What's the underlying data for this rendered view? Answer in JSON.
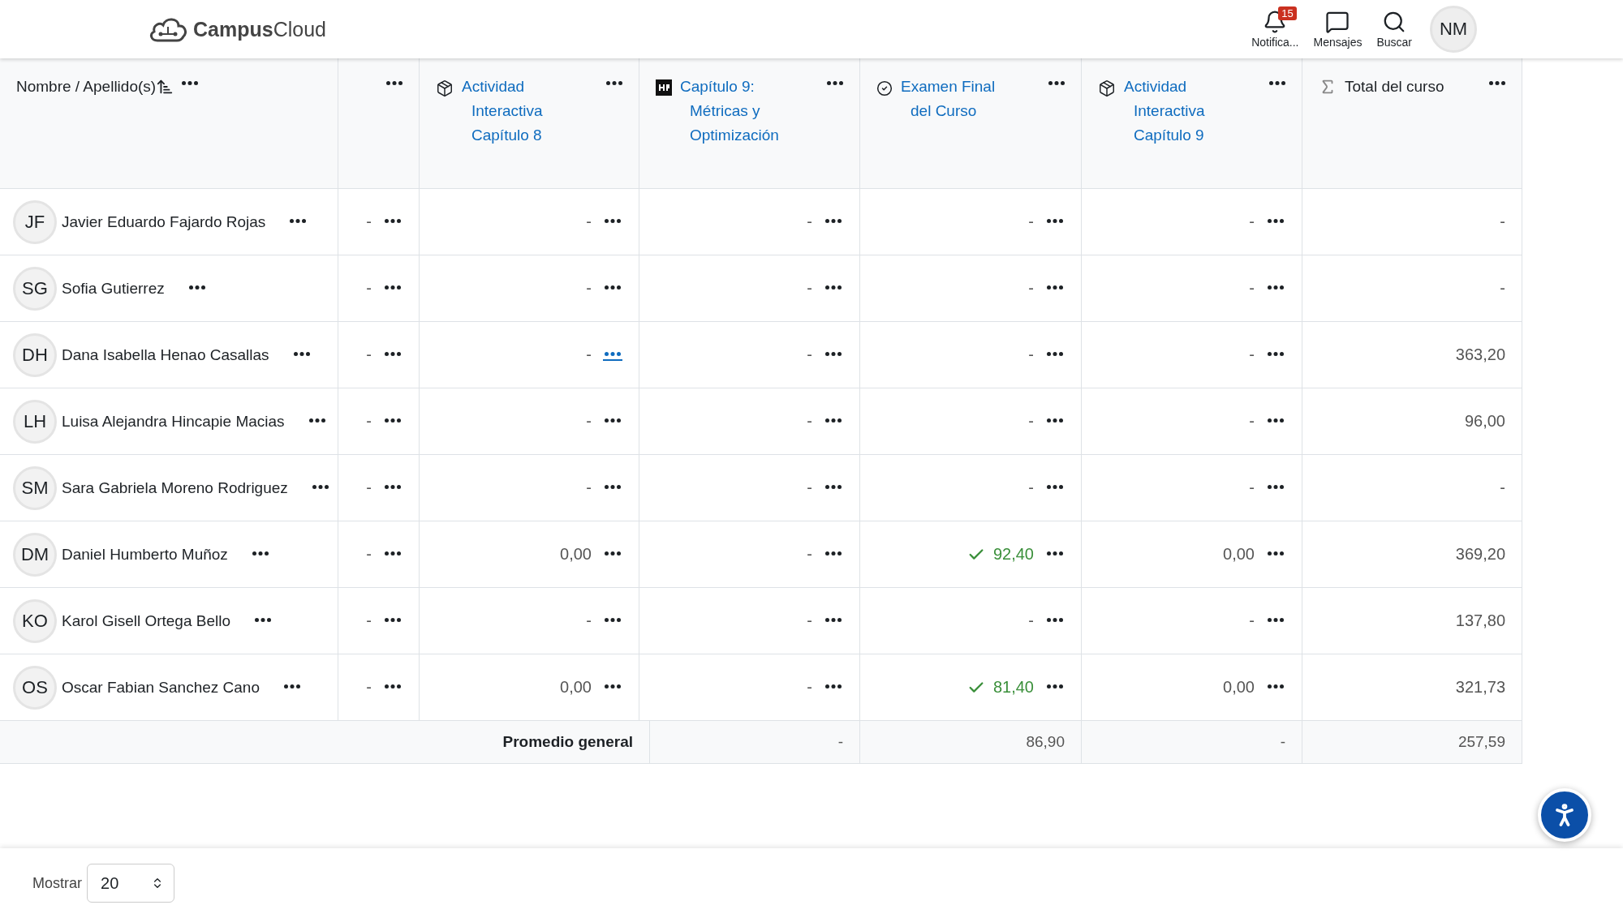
{
  "brand": "**Campus**Cloud",
  "nav": [
    {
      "kind": "bell",
      "label": "Notifica...",
      "badge": "15"
    },
    {
      "kind": "messages",
      "label": "Mensajes"
    },
    {
      "kind": "search",
      "label": "Buscar"
    }
  ],
  "user_initials": "NM",
  "name_header": "Nombre / Apellido(s)",
  "columns": [
    {
      "kind": "blank"
    },
    {
      "kind": "activity",
      "title_lines": [
        "Actividad",
        "Interactiva",
        "Capítulo 8"
      ]
    },
    {
      "kind": "h5p",
      "title_lines": [
        "Capítulo 9:",
        "Métricas y",
        "Optimización"
      ]
    },
    {
      "kind": "quiz",
      "title_lines": [
        "Examen Final",
        "del Curso"
      ]
    },
    {
      "kind": "activity",
      "title_lines": [
        "Actividad",
        "Interactiva",
        "Capítulo 9"
      ]
    }
  ],
  "total_header": "Total del curso",
  "rows": [
    {
      "initials": "JF",
      "name": "Javier Eduardo Fajardo Rojas",
      "grades": [
        {
          "value": "-",
          "passed": false,
          "focused": false
        },
        {
          "value": "-",
          "passed": false,
          "focused": false
        },
        {
          "value": "-",
          "passed": false,
          "focused": false
        },
        {
          "value": "-",
          "passed": false,
          "focused": false
        },
        {
          "value": "-",
          "passed": false,
          "focused": false
        }
      ],
      "total": "-"
    },
    {
      "initials": "SG",
      "name": "Sofia Gutierrez",
      "grades": [
        {
          "value": "-",
          "passed": false,
          "focused": false
        },
        {
          "value": "-",
          "passed": false,
          "focused": false
        },
        {
          "value": "-",
          "passed": false,
          "focused": false
        },
        {
          "value": "-",
          "passed": false,
          "focused": false
        },
        {
          "value": "-",
          "passed": false,
          "focused": false
        }
      ],
      "total": "-"
    },
    {
      "initials": "DH",
      "name": "Dana Isabella Henao Casallas",
      "grades": [
        {
          "value": "-",
          "passed": false,
          "focused": false
        },
        {
          "value": "-",
          "passed": false,
          "focused": true
        },
        {
          "value": "-",
          "passed": false,
          "focused": false
        },
        {
          "value": "-",
          "passed": false,
          "focused": false
        },
        {
          "value": "-",
          "passed": false,
          "focused": false
        }
      ],
      "total": "363,20"
    },
    {
      "initials": "LH",
      "name": "Luisa Alejandra Hincapie Macias",
      "grades": [
        {
          "value": "-",
          "passed": false,
          "focused": false
        },
        {
          "value": "-",
          "passed": false,
          "focused": false
        },
        {
          "value": "-",
          "passed": false,
          "focused": false
        },
        {
          "value": "-",
          "passed": false,
          "focused": false
        },
        {
          "value": "-",
          "passed": false,
          "focused": false
        }
      ],
      "total": "96,00"
    },
    {
      "initials": "SM",
      "name": "Sara Gabriela Moreno Rodriguez",
      "grades": [
        {
          "value": "-",
          "passed": false,
          "focused": false
        },
        {
          "value": "-",
          "passed": false,
          "focused": false
        },
        {
          "value": "-",
          "passed": false,
          "focused": false
        },
        {
          "value": "-",
          "passed": false,
          "focused": false
        },
        {
          "value": "-",
          "passed": false,
          "focused": false
        }
      ],
      "total": "-"
    },
    {
      "initials": "DM",
      "name": "Daniel Humberto Muñoz",
      "grades": [
        {
          "value": "-",
          "passed": false,
          "focused": false
        },
        {
          "value": "0,00",
          "passed": false,
          "focused": false
        },
        {
          "value": "-",
          "passed": false,
          "focused": false
        },
        {
          "value": "92,40",
          "passed": true,
          "focused": false
        },
        {
          "value": "0,00",
          "passed": false,
          "focused": false
        }
      ],
      "total": "369,20"
    },
    {
      "initials": "KO",
      "name": "Karol Gisell Ortega Bello",
      "grades": [
        {
          "value": "-",
          "passed": false,
          "focused": false
        },
        {
          "value": "-",
          "passed": false,
          "focused": false
        },
        {
          "value": "-",
          "passed": false,
          "focused": false
        },
        {
          "value": "-",
          "passed": false,
          "focused": false
        },
        {
          "value": "-",
          "passed": false,
          "focused": false
        }
      ],
      "total": "137,80"
    },
    {
      "initials": "OS",
      "name": "Oscar Fabian Sanchez Cano",
      "grades": [
        {
          "value": "-",
          "passed": false,
          "focused": false
        },
        {
          "value": "0,00",
          "passed": false,
          "focused": false
        },
        {
          "value": "-",
          "passed": false,
          "focused": false
        },
        {
          "value": "81,40",
          "passed": true,
          "focused": false
        },
        {
          "value": "0,00",
          "passed": false,
          "focused": false
        }
      ],
      "total": "321,73"
    }
  ],
  "average": {
    "label": "Promedio general",
    "values": [
      "-",
      "86,90",
      "-",
      "257,59"
    ]
  },
  "show": {
    "label": "Mostrar",
    "value": "20"
  }
}
